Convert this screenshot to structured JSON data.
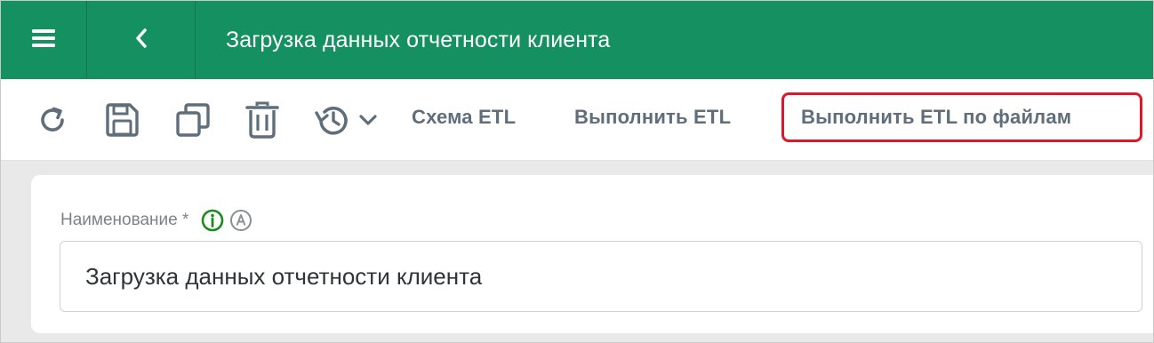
{
  "header": {
    "title": "Загрузка данных отчетности клиента",
    "menu_icon": "hamburger-menu-icon",
    "back_icon": "chevron-left-icon",
    "background_color": "#159060"
  },
  "toolbar": {
    "icons": [
      "refresh-icon",
      "save-icon",
      "copy-icon",
      "delete-icon",
      "history-icon"
    ],
    "etl_schema_label": "Схема ETL",
    "run_etl_label": "Выполнить ETL",
    "run_etl_files_label": "Выполнить ETL по файлам",
    "highlight_color": "#e0162b"
  },
  "form": {
    "name_label": "Наименование *",
    "name_value": "Загрузка данных отчетности клиента",
    "info_icon": "info-icon",
    "auto_icon": "a-circle-icon"
  }
}
